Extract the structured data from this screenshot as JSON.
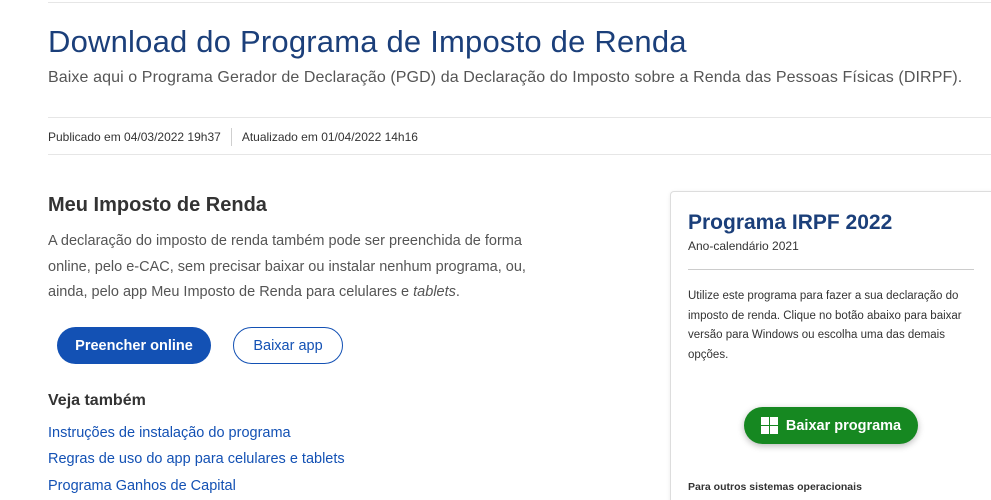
{
  "header": {
    "title": "Download do Programa de Imposto de Renda",
    "subtitle": "Baixe aqui o Programa Gerador de Declaração (PGD) da Declaração do Imposto sobre a Renda das Pessoas Físicas (DIRPF)."
  },
  "meta": {
    "published": "Publicado em 04/03/2022 19h37",
    "updated": "Atualizado em 01/04/2022 14h16"
  },
  "main": {
    "section_title": "Meu Imposto de Renda",
    "section_text": "A declaração do imposto de renda também pode ser preenchida de forma online, pelo e-CAC, sem precisar baixar ou instalar nenhum programa, ou, ainda, pelo app Meu Imposto de Renda para celulares e ",
    "section_text_em": "tablets",
    "section_text_end": ".",
    "primary_button": "Preencher online",
    "secondary_button": "Baixar app",
    "see_also_title": "Veja também",
    "links": [
      "Instruções de instalação do programa",
      "Regras de uso do app para celulares e tablets",
      "Programa Ganhos de Capital"
    ]
  },
  "card": {
    "title": "Programa IRPF 2022",
    "subtitle": "Ano-calendário 2021",
    "text": "Utilize este programa para fazer a sua declaração do imposto de renda. Clique no botão abaixo para baixar versão para Windows ou escolha uma das demais opções.",
    "download_button": "Baixar programa",
    "download_icon": "windows-icon",
    "footer": "Para outros sistemas operacionais"
  },
  "colors": {
    "title_blue": "#1b3f7a",
    "primary_blue": "#1351b4",
    "download_green": "#168821"
  }
}
